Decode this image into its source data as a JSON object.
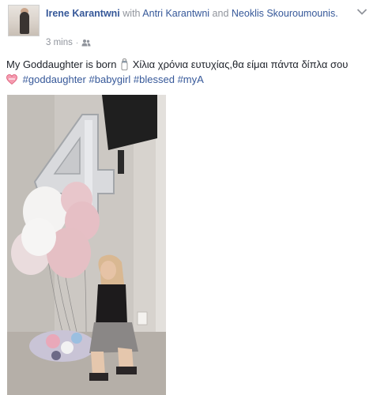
{
  "post": {
    "author": "Irene Karantwni",
    "with_word": "with",
    "tagged_1": "Antri Karantwni",
    "and_word": "and",
    "tagged_2": "Neoklis Skouroumounis.",
    "time": "3 mins",
    "separator": "·",
    "audience_icon": "friends-icon",
    "message": "My Goddaughter is born",
    "message_greek": "Χίλια χρόνια ευτυχίας,θα είμαι πάντα δίπλα σου",
    "hashtags": [
      "#goddaughter",
      "#babygirl",
      "#blessed",
      "#myA"
    ]
  },
  "colors": {
    "link": "#365899",
    "meta": "#90949c",
    "text": "#1d2129"
  }
}
